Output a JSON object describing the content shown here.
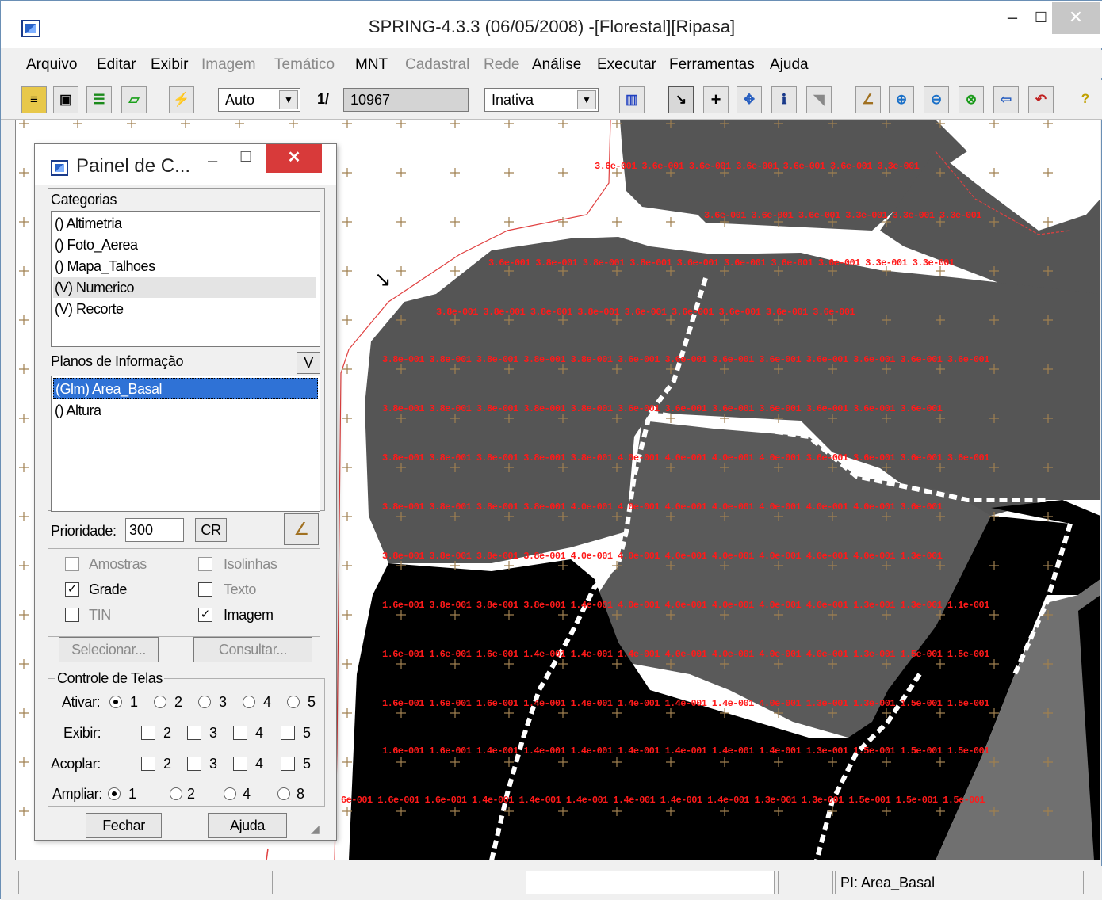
{
  "window": {
    "title": "SPRING-4.3.3 (06/05/2008) -[Florestal][Ripasa]"
  },
  "menu": [
    {
      "label": "Arquivo",
      "enabled": true
    },
    {
      "label": "Editar",
      "enabled": true
    },
    {
      "label": "Exibir",
      "enabled": true
    },
    {
      "label": "Imagem",
      "enabled": false
    },
    {
      "label": "Temático",
      "enabled": false
    },
    {
      "label": "MNT",
      "enabled": true
    },
    {
      "label": "Cadastral",
      "enabled": false
    },
    {
      "label": "Rede",
      "enabled": false
    },
    {
      "label": "Análise",
      "enabled": true
    },
    {
      "label": "Executar",
      "enabled": true
    },
    {
      "label": "Ferramentas",
      "enabled": true
    },
    {
      "label": "Ajuda",
      "enabled": true
    }
  ],
  "toolbar": {
    "mode_combo": "Auto",
    "scale_prefix": "1/",
    "scale_value": "10967",
    "state_combo": "Inativa",
    "help_glyph": "?"
  },
  "panel": {
    "title": "Painel de C...",
    "categorias_label": "Categorias",
    "categorias": [
      "() Altimetria",
      "() Foto_Aerea",
      "() Mapa_Talhoes",
      "(V) Numerico",
      "(V) Recorte"
    ],
    "planos_label": "Planos de Informação",
    "planos_btn": "V",
    "planos": [
      "(Glm) Area_Basal",
      "() Altura"
    ],
    "prioridade_label": "Prioridade:",
    "prioridade_value": "300",
    "cr_label": "CR",
    "chk_amostras": "Amostras",
    "chk_isolinhas": "Isolinhas",
    "chk_grade": "Grade",
    "chk_texto": "Texto",
    "chk_tin": "TIN",
    "chk_imagem": "Imagem",
    "selecionar": "Selecionar...",
    "consultar": "Consultar...",
    "controle_label": "Controle de Telas",
    "ativar_label": "Ativar:",
    "exibir_label": "Exibir:",
    "acoplar_label": "Acoplar:",
    "ampliar_label": "Ampliar:",
    "nums_5": [
      "1",
      "2",
      "3",
      "4",
      "5"
    ],
    "nums_4": [
      "2",
      "3",
      "4",
      "5"
    ],
    "ampliar_nums": [
      "1",
      "2",
      "4",
      "8"
    ],
    "fechar": "Fechar",
    "ajuda": "Ajuda"
  },
  "grid_rows": [
    "3.6e-001 3.6e-001 3.6e-001 3.6e-001 3.6e-001 3.6e-001 3.3e-001",
    "3.6e-001 3.6e-001 3.6e-001 3.3e-001 3.3e-001 3.3e-001",
    "3.6e-001 3.8e-001 3.8e-001 3.8e-001 3.6e-001 3.6e-001 3.6e-001 3.6e-001      3.3e-001 3.3e-001",
    "3.8e-001 3.8e-001 3.8e-001 3.8e-001 3.6e-001 3.6e-001 3.6e-001 3.6e-001 3.6e-001",
    "3.8e-001 3.8e-001 3.8e-001 3.8e-001 3.8e-001 3.6e-001 3.6e-001 3.6e-001 3.6e-001 3.6e-001 3.6e-001 3.6e-001 3.6e-001",
    "3.8e-001 3.8e-001 3.8e-001 3.8e-001 3.8e-001      3.6e-001 3.6e-001 3.6e-001 3.6e-001 3.6e-001 3.6e-001 3.6e-001",
    "3.8e-001 3.8e-001 3.8e-001 3.8e-001 3.8e-001 4.0e-001 4.0e-001 4.0e-001 4.0e-001      3.6e-001 3.6e-001 3.6e-001 3.6e-001",
    "3.8e-001 3.8e-001 3.8e-001 3.8e-001 4.0e-001 4.0e-001 4.0e-001 4.0e-001 4.0e-001 4.0e-001 4.0e-001      3.6e-001",
    "3.8e-001 3.8e-001 3.8e-001 3.8e-001 4.0e-001 4.0e-001 4.0e-001 4.0e-001 4.0e-001 4.0e-001 4.0e-001 1.3e-001",
    "1.6e-001 3.8e-001 3.8e-001 3.8e-001 1.4e-001 4.0e-001 4.0e-001 4.0e-001 4.0e-001 4.0e-001 1.3e-001 1.3e-001 1.1e-001",
    "1.6e-001 1.6e-001 1.6e-001 1.4e-001 1.4e-001 1.4e-001 4.0e-001 4.0e-001 4.0e-001 4.0e-001 1.3e-001 1.5e-001 1.5e-001",
    "1.6e-001 1.6e-001 1.6e-001 1.4e-001 1.4e-001 1.4e-001 1.4e-001 1.4e-001 4.0e-001 1.3e-001 1.3e-001 1.5e-001 1.5e-001",
    "1.6e-001 1.6e-001 1.4e-001 1.4e-001 1.4e-001 1.4e-001 1.4e-001 1.4e-001 1.4e-001      1.3e-001 1.5e-001 1.5e-001 1.5e-001",
    "6e-001 1.6e-001 1.6e-001 1.4e-001 1.4e-001 1.4e-001 1.4e-001 1.4e-001 1.4e-001 1.3e-001 1.3e-001 1.5e-001 1.5e-001 1.5e-001"
  ],
  "status": {
    "pi": "PI: Area_Basal"
  },
  "colors": {
    "region_dark_gray": "#555555",
    "region_black": "#000000",
    "region_light_gray": "#707070",
    "grid_label": "#ff1a1a",
    "grid_cross": "#a08050",
    "boundary_line": "#e04040",
    "selection_blue": "#2f72d6",
    "close_red": "#d83a3a"
  }
}
